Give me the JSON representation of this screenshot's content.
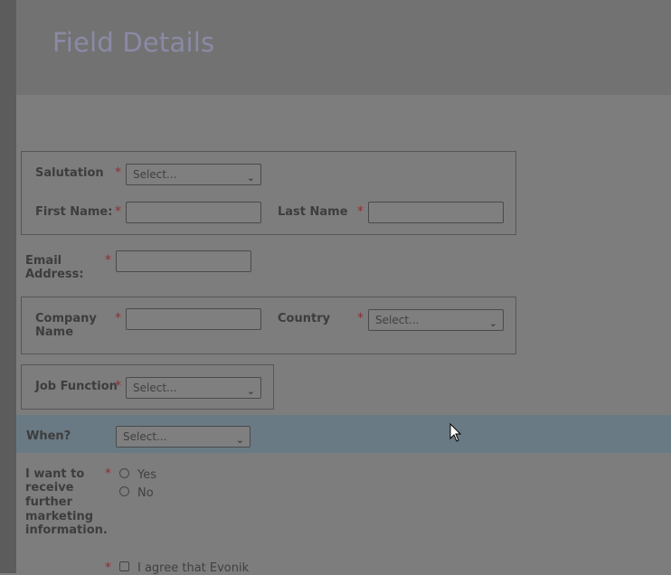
{
  "page": {
    "title": "Field Details"
  },
  "form": {
    "required_mark": "*",
    "salutation": {
      "label": "Salutation",
      "value": "Select..."
    },
    "first_name": {
      "label": "First Name:",
      "value": ""
    },
    "last_name": {
      "label": "Last Name",
      "value": ""
    },
    "email": {
      "label_line1": "Email",
      "label_line2": "Address:",
      "value": ""
    },
    "company_name": {
      "label_line1": "Company",
      "label_line2": "Name",
      "value": ""
    },
    "country": {
      "label": "Country",
      "value": "Select..."
    },
    "job_function": {
      "label": "Job Function",
      "value": "Select..."
    },
    "when": {
      "label": "When?",
      "value": "Select..."
    },
    "marketing": {
      "label_lines": [
        "I want to",
        "receive",
        "further",
        "marketing",
        "information."
      ],
      "options": [
        "Yes",
        "No"
      ]
    },
    "agree": {
      "label": "I agree that Evonik"
    }
  },
  "icons": {
    "select_chevron": "chevron-down-icon",
    "cursor": "mouse-pointer-icon"
  }
}
